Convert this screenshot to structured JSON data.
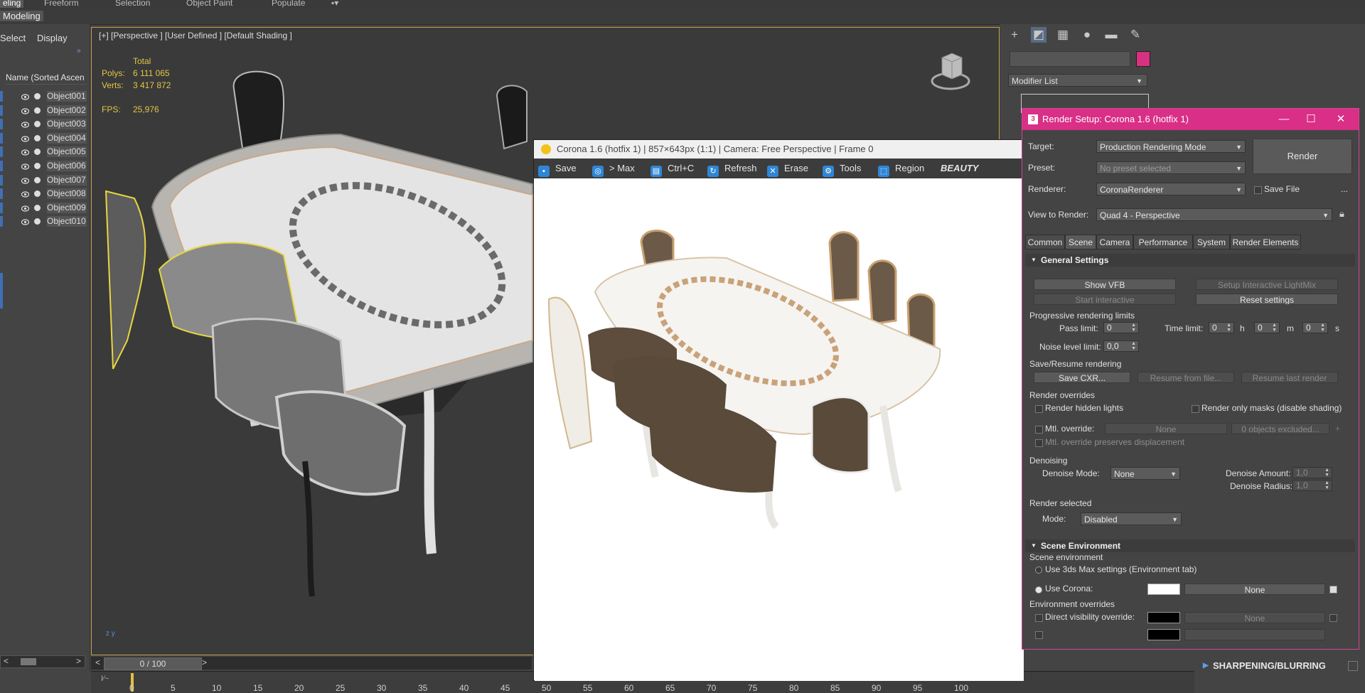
{
  "ribbon": {
    "tabs": [
      "eling",
      "Freeform",
      "Selection",
      "Object Paint",
      "Populate"
    ],
    "panel_label": "Modeling"
  },
  "explorer": {
    "menu": [
      "Select",
      "Display"
    ],
    "column_header": "Name (Sorted Ascen",
    "objects": [
      "Object001",
      "Object002",
      "Object003",
      "Object004",
      "Object005",
      "Object006",
      "Object007",
      "Object008",
      "Object009",
      "Object010"
    ]
  },
  "viewport": {
    "label": "[+] [Perspective ] [User Defined ] [Default Shading ]",
    "stats": {
      "total_label": "Total",
      "polys_label": "Polys:",
      "polys_value": "6 111 065",
      "verts_label": "Verts:",
      "verts_value": "3 417 872",
      "fps_label": "FPS:",
      "fps_value": "25,976"
    }
  },
  "timeline": {
    "slider_text": "0 / 100",
    "ticks": [
      "0",
      "5",
      "10",
      "15",
      "20",
      "25",
      "30",
      "35",
      "40",
      "45",
      "50",
      "55",
      "60",
      "65",
      "70",
      "75",
      "80",
      "85",
      "90",
      "95",
      "100"
    ]
  },
  "command_panel": {
    "modifier_list": "Modifier List",
    "icons": [
      "create-icon",
      "modify-icon",
      "hierarchy-icon",
      "motion-icon",
      "display-icon",
      "utilities-icon"
    ],
    "rollout": "SHARPENING/BLURRING",
    "object_color": "#d7317f"
  },
  "vfb": {
    "title": "Corona 1.6 (hotfix 1) | 857×643px (1:1) | Camera: Free Perspective | Frame 0",
    "buttons": [
      "Save",
      "> Max",
      "Ctrl+C",
      "Refresh",
      "Erase",
      "Tools",
      "Region"
    ],
    "channel": "BEAUTY"
  },
  "render_setup": {
    "title": "Render Setup: Corona 1.6 (hotfix 1)",
    "target_label": "Target:",
    "target_value": "Production Rendering Mode",
    "preset_label": "Preset:",
    "preset_value": "No preset selected",
    "renderer_label": "Renderer:",
    "renderer_value": "CoronaRenderer",
    "save_file": "Save File",
    "more": "...",
    "view_label": "View to Render:",
    "view_value": "Quad 4 - Perspective",
    "render_button": "Render",
    "tabs": [
      "Common",
      "Scene",
      "Camera",
      "Performance",
      "System",
      "Render Elements"
    ],
    "general_settings": "General Settings",
    "show_vfb": "Show VFB",
    "setup_lightmix": "Setup Interactive LightMix",
    "start_interactive": "Start interactive",
    "reset_settings": "Reset settings",
    "prog_limits": "Progressive rendering limits",
    "pass_limit_label": "Pass limit:",
    "pass_limit_value": "0",
    "time_limit_label": "Time limit:",
    "time_h": "0",
    "time_m": "0",
    "time_s": "0",
    "h": "h",
    "m": "m",
    "s": "s",
    "noise_label": "Noise level limit:",
    "noise_value": "0,0",
    "save_resume": "Save/Resume rendering",
    "save_cxr": "Save CXR...",
    "resume_file": "Resume from file...",
    "resume_last": "Resume last render",
    "overrides": "Render overrides",
    "render_hidden": "Render hidden lights",
    "render_masks": "Render only masks (disable shading)",
    "mtl_override": "Mtl. override:",
    "mtl_none": "None",
    "objects_excluded": "0 objects excluded...",
    "mtl_preserves": "Mtl. override preserves displacement",
    "denoising": "Denoising",
    "denoise_mode_label": "Denoise Mode:",
    "denoise_mode_value": "None",
    "denoise_amount_label": "Denoise Amount:",
    "denoise_amount_value": "1,0",
    "denoise_radius_label": "Denoise Radius:",
    "denoise_radius_value": "1,0",
    "render_selected": "Render selected",
    "mode_label": "Mode:",
    "mode_value": "Disabled",
    "scene_env": "Scene Environment",
    "scene_env_sub": "Scene environment",
    "use_3dsmax": "Use 3ds Max settings (Environment tab)",
    "use_corona": "Use Corona:",
    "corona_map": "None",
    "env_overrides": "Environment overrides",
    "direct_vis": "Direct visibility override:",
    "direct_map": "None"
  }
}
